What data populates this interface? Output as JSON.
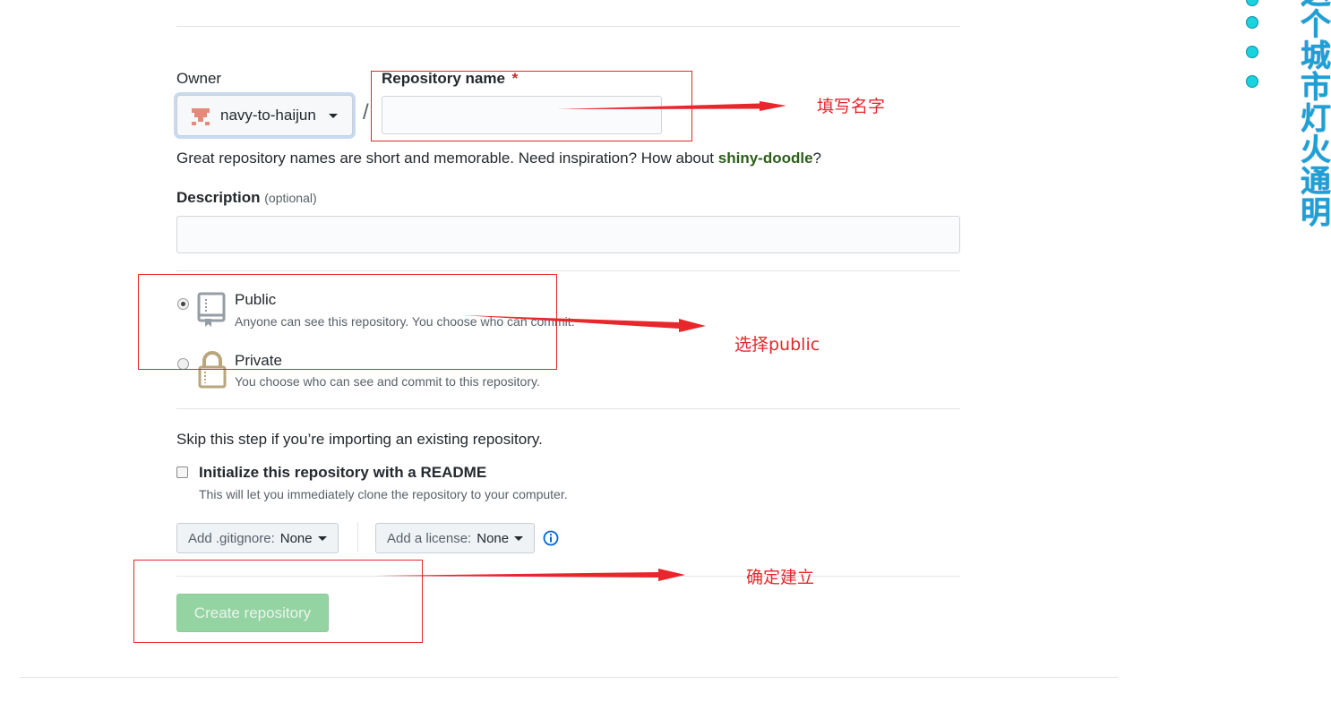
{
  "owner": {
    "label": "Owner",
    "name": "navy-to-haijun"
  },
  "repo": {
    "label": "Repository name",
    "required_mark": "*",
    "value": "",
    "separator": "/"
  },
  "hint": {
    "prefix": "Great repository names are short and memorable. Need inspiration? How about ",
    "suggestion": "shiny-doodle",
    "suffix": "?"
  },
  "description": {
    "label": "Description",
    "optional": "(optional)",
    "value": ""
  },
  "visibility": {
    "public": {
      "title": "Public",
      "desc": "Anyone can see this repository. You choose who can commit.",
      "checked": true
    },
    "private": {
      "title": "Private",
      "desc": "You choose who can see and commit to this repository.",
      "checked": false
    }
  },
  "import": {
    "skip_text": "Skip this step if you’re importing an existing repository."
  },
  "readme": {
    "title": "Initialize this repository with a README",
    "desc": "This will let you immediately clone the repository to your computer.",
    "checked": false
  },
  "gitignore": {
    "prefix": "Add .gitignore:",
    "value": "None"
  },
  "license": {
    "prefix": "Add a license:",
    "value": "None"
  },
  "create_button": "Create repository",
  "annotations": {
    "fill_name": "填写名字",
    "choose_public": "选择public",
    "confirm_create": "确定建立"
  },
  "sidebar": {
    "vertical_title": "这个城市灯火通明"
  },
  "colors": {
    "annotation_red": "#e8262b",
    "link_green": "#2c5e1a",
    "button_green": "#94d3a2",
    "accent_cyan": "#19d3df"
  }
}
